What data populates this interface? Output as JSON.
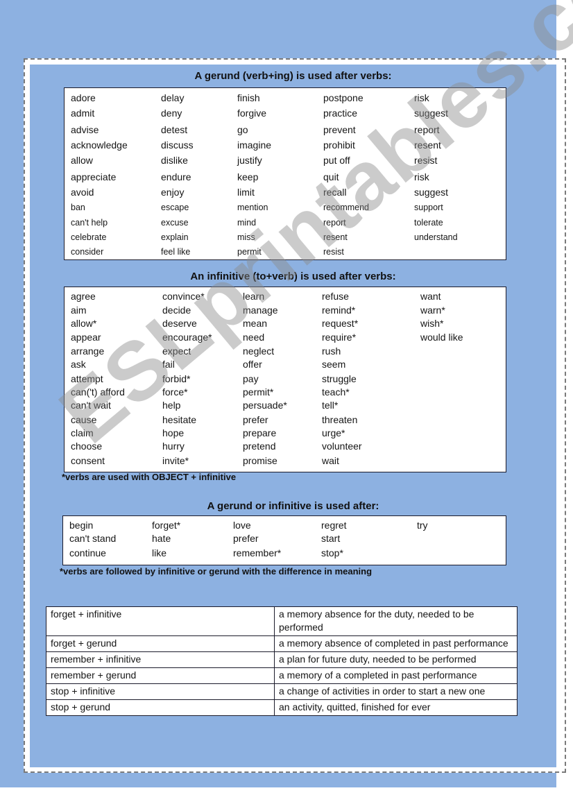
{
  "section1": {
    "title": "A gerund (verb+ing) is used after verbs:",
    "columns": [
      [
        "adore",
        "admit",
        "advise",
        "acknowledge",
        "allow",
        "appreciate",
        "avoid",
        "ban",
        "can't help",
        "celebrate",
        "consider"
      ],
      [
        "delay",
        "deny",
        "detest",
        "discuss",
        "dislike",
        "endure",
        "enjoy",
        "escape",
        "excuse",
        "explain",
        "feel like"
      ],
      [
        "finish",
        "forgive",
        "go",
        "imagine",
        "justify",
        "keep",
        "limit",
        "mention",
        "mind",
        "miss",
        "permit"
      ],
      [
        "postpone",
        "practice",
        "prevent",
        "prohibit",
        "put off",
        "quit",
        "recall",
        "recommend",
        "report",
        "resent",
        "resist"
      ],
      [
        "risk",
        "suggest",
        "report",
        "resent",
        "resist",
        "risk",
        "suggest",
        "support",
        "tolerate",
        "understand"
      ]
    ]
  },
  "section2": {
    "title": "An infinitive (to+verb) is used after verbs:",
    "columns": [
      [
        "agree",
        "aim",
        "allow*",
        "appear",
        "arrange",
        "ask",
        "attempt",
        "can('t) afford",
        "can't wait",
        "cause",
        "claim",
        "choose",
        "consent"
      ],
      [
        "convince*",
        "decide",
        "deserve",
        "encourage*",
        "expect",
        "fail",
        "forbid*",
        "force*",
        "help",
        "hesitate",
        "hope",
        "hurry",
        "invite*"
      ],
      [
        "learn",
        "manage",
        "mean",
        "need",
        "neglect",
        "offer",
        "pay",
        "permit*",
        "persuade*",
        "prefer",
        "prepare",
        "pretend",
        "promise"
      ],
      [
        "refuse",
        "remind*",
        "request*",
        "require*",
        "rush",
        "seem",
        "struggle",
        "teach*",
        "tell*",
        "threaten",
        "urge*",
        "volunteer",
        "wait"
      ],
      [
        "want",
        "warn*",
        "wish*",
        "would like"
      ]
    ],
    "note": "*verbs are used with OBJECT + infinitive"
  },
  "section3": {
    "title": "A gerund or infinitive is used after:",
    "columns": [
      [
        "begin",
        "can't stand",
        "continue"
      ],
      [
        "forget*",
        "hate",
        "like"
      ],
      [
        "love",
        "prefer",
        "remember*"
      ],
      [
        "regret",
        "start",
        "stop*"
      ],
      [
        "try"
      ]
    ],
    "note": "*verbs are followed by infinitive or gerund with the difference in meaning"
  },
  "meanings": [
    {
      "form": "forget + infinitive",
      "meaning": "a memory absence for the duty, needed to be performed"
    },
    {
      "form": "forget + gerund",
      "meaning": "a memory absence of completed in past performance"
    },
    {
      "form": "remember + infinitive",
      "meaning": "a plan for future duty, needed to be performed"
    },
    {
      "form": "remember + gerund",
      "meaning": "a memory of a completed in past performance"
    },
    {
      "form": "stop + infinitive",
      "meaning": "a change of activities in order to start a new one"
    },
    {
      "form": "stop + gerund",
      "meaning": "an activity, quitted, finished for ever"
    }
  ],
  "watermark": "ESLprintables.com",
  "colors": {
    "background_blue": "#8db1e1",
    "frame_dash": "#7a7a7a"
  }
}
